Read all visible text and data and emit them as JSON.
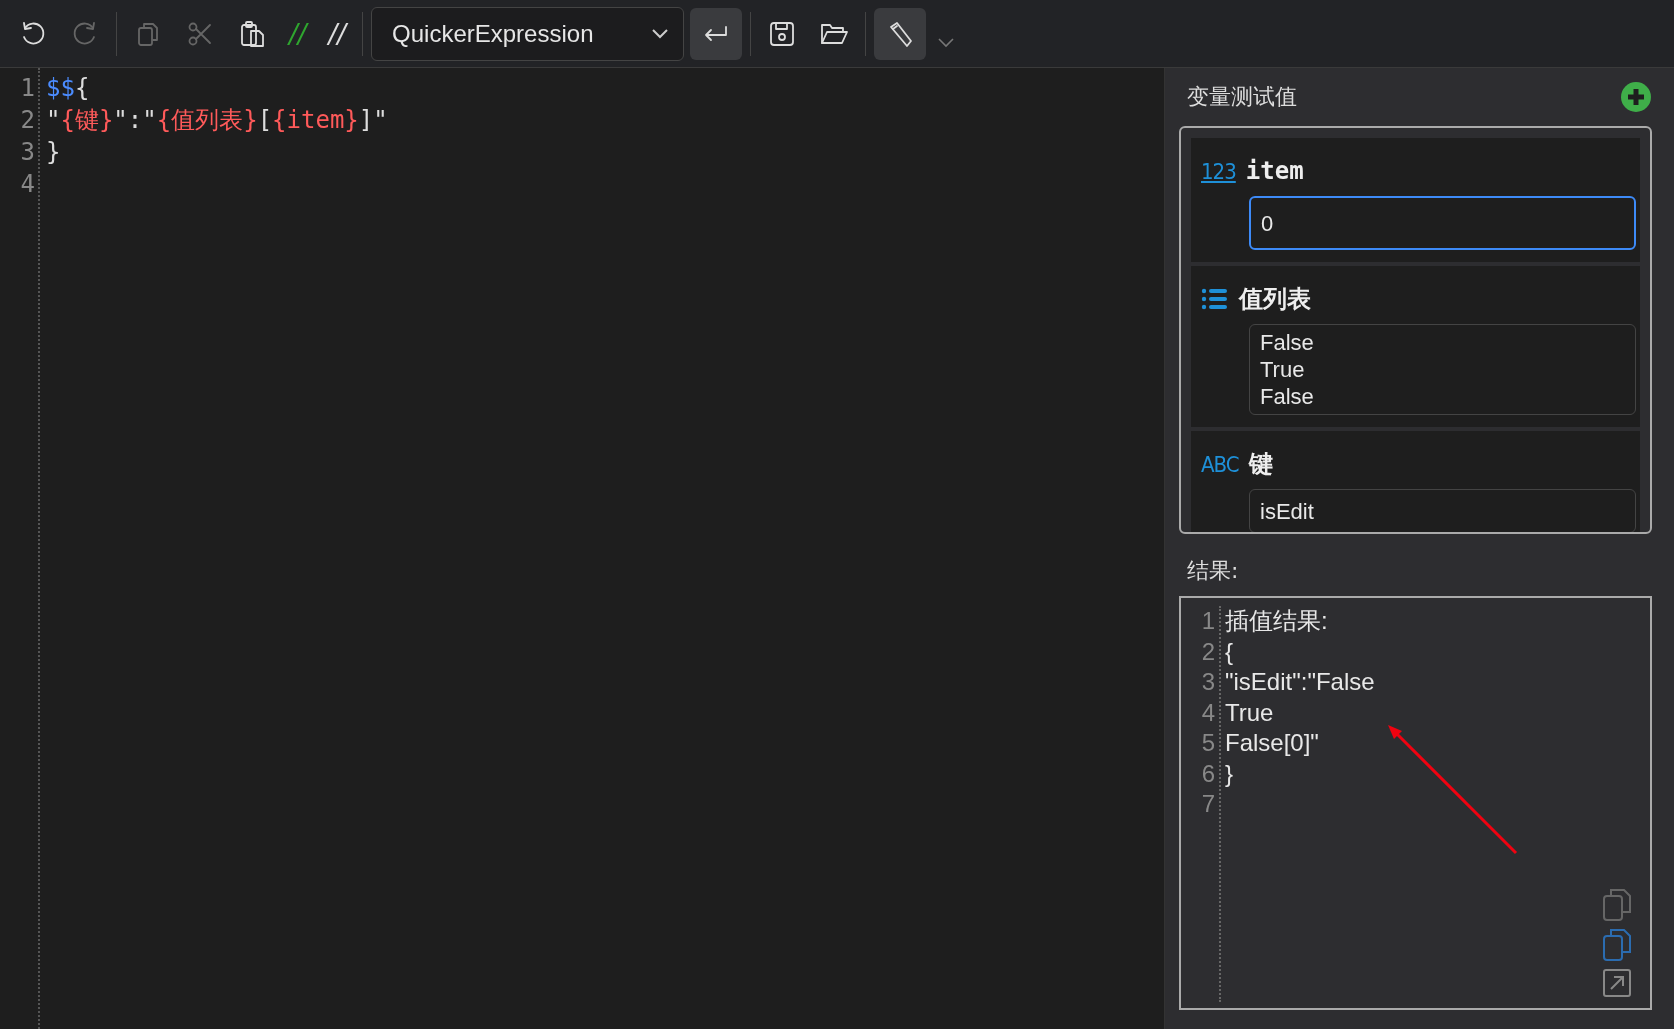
{
  "toolbar": {
    "items": [
      {
        "kind": "undo",
        "disabled": false
      },
      {
        "kind": "redo",
        "disabled": true
      },
      {
        "kind": "divider"
      },
      {
        "kind": "copy",
        "disabled": true
      },
      {
        "kind": "cut",
        "disabled": true
      },
      {
        "kind": "paste",
        "disabled": false
      },
      {
        "kind": "comment",
        "label": "//"
      },
      {
        "kind": "uncomment",
        "label": "//"
      },
      {
        "kind": "divider"
      },
      {
        "kind": "dropdown",
        "label": "QuickerExpression"
      },
      {
        "kind": "enter",
        "on": true
      },
      {
        "kind": "divider"
      },
      {
        "kind": "save",
        "disabled": false
      },
      {
        "kind": "open",
        "disabled": false
      },
      {
        "kind": "divider"
      },
      {
        "kind": "tag",
        "on": true
      },
      {
        "kind": "more"
      }
    ]
  },
  "editor": {
    "line_numbers": [
      "1",
      "2",
      "3",
      "4"
    ],
    "lines": [
      [
        {
          "kind": "keyword",
          "text": "$$"
        },
        {
          "kind": "plain",
          "text": "{"
        }
      ],
      [
        {
          "kind": "plain",
          "text": "\""
        },
        {
          "kind": "interp",
          "text": "{键}"
        },
        {
          "kind": "plain",
          "text": "\":\""
        },
        {
          "kind": "interp",
          "text": "{值列表}"
        },
        {
          "kind": "plain",
          "text": "["
        },
        {
          "kind": "interp",
          "text": "{item}"
        },
        {
          "kind": "plain",
          "text": "]\""
        }
      ],
      [
        {
          "kind": "plain",
          "text": "}"
        }
      ]
    ]
  },
  "variables": {
    "title": "变量测试值",
    "items": [
      {
        "kind": "number",
        "type_label": "123",
        "name": "item",
        "value": [
          "0"
        ],
        "focused": true
      },
      {
        "kind": "list",
        "name": "值列表",
        "value": [
          "False",
          "True",
          "False"
        ],
        "focused": false
      },
      {
        "kind": "text",
        "type_label": "ABC",
        "name": "键",
        "value": [
          "isEdit"
        ],
        "focused": false
      }
    ]
  },
  "result": {
    "label": "结果:",
    "line_numbers": [
      "1",
      "2",
      "3",
      "4",
      "5",
      "6",
      "7"
    ],
    "lines": [
      "插值结果:",
      "{",
      "\"isEdit\":\"False",
      "True",
      "False[0]\"",
      "}"
    ]
  }
}
